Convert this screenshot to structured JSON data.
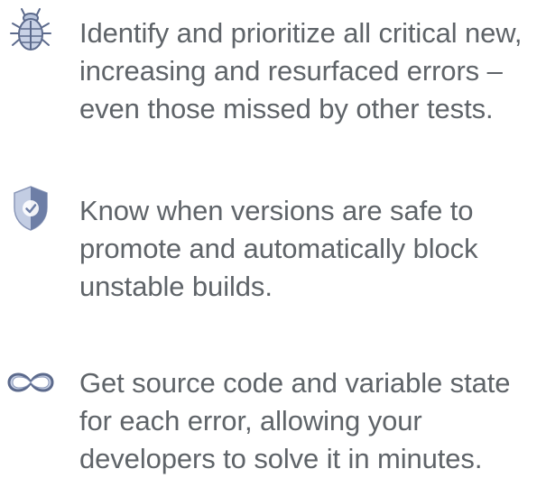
{
  "features": [
    {
      "icon": "bug-icon",
      "text": "Identify and prioritize all critical new, increasing and resurfaced errors – even those missed by other tests."
    },
    {
      "icon": "shield-check-icon",
      "text": "Know when versions are safe to promote and automatically block unstable builds."
    },
    {
      "icon": "infinity-icon",
      "text": "Get source code and variable state for each error,  allowing your developers to solve it in minutes."
    }
  ],
  "colors": {
    "text": "#5f6469",
    "icon_dark": "#5c6a8c",
    "icon_light": "#b8c4dc"
  }
}
